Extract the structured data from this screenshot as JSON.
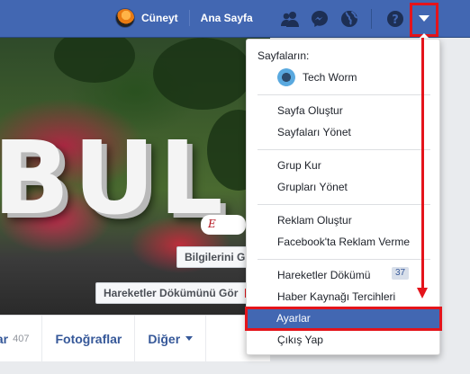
{
  "topbar": {
    "user_name": "Cüneyt",
    "home_label": "Ana Sayfa"
  },
  "icons": {
    "friends": "friend-requests-icon",
    "messages": "messenger-icon",
    "notifications": "globe-icon",
    "help": "help-icon",
    "account_menu": "chevron-down-icon"
  },
  "cover": {
    "update_info_button": "Bilgilerini Gü",
    "activity_log_button": "Hareketler Dökümünü Gör",
    "sign_text": "E"
  },
  "profile_tabs": [
    {
      "label": "lar",
      "count": "407"
    },
    {
      "label": "Fotoğraflar"
    },
    {
      "label": "Diğer"
    }
  ],
  "menu": {
    "pages_heading": "Sayfaların:",
    "page_name": "Tech Worm",
    "items": {
      "create_page": "Sayfa Oluştur",
      "manage_pages": "Sayfaları Yönet",
      "create_group": "Grup Kur",
      "manage_groups": "Grupları Yönet",
      "create_ad": "Reklam Oluştur",
      "advertise": "Facebook'ta Reklam Verme",
      "activity_log": "Hareketler Dökümü",
      "activity_count": "37",
      "news_feed_prefs": "Haber Kaynağı Tercihleri",
      "settings": "Ayarlar",
      "logout": "Çıkış Yap"
    }
  },
  "colors": {
    "brand_blue": "#4267b2",
    "annotation_red": "#e4141b"
  }
}
